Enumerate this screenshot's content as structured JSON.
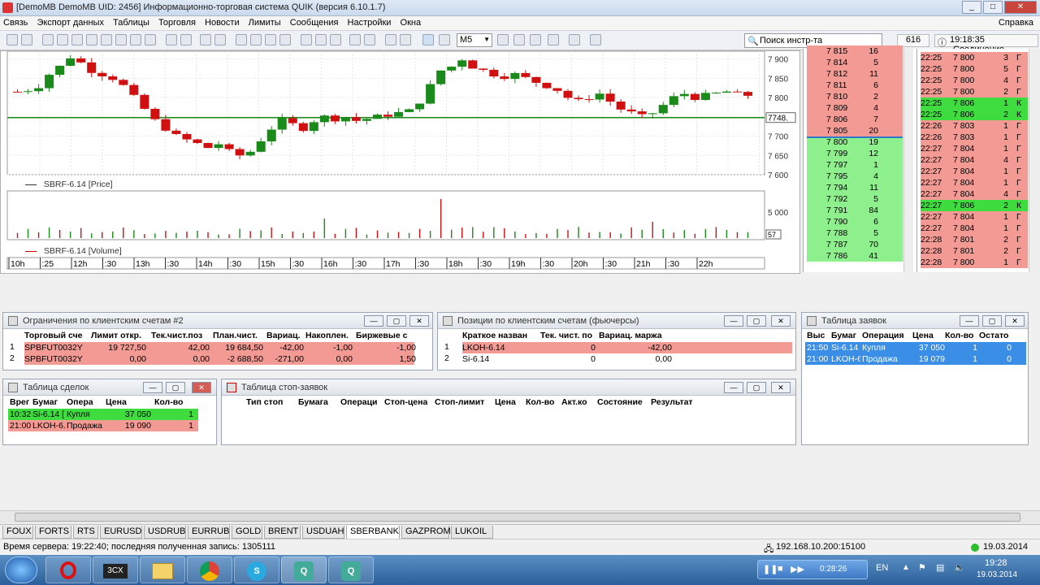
{
  "window": {
    "title": "[DemoMB DemoMB  UID: 2456] Информационно-торговая система QUIK (версия 6.10.1.7)"
  },
  "menu": [
    "Связь",
    "Экспорт данных",
    "Таблицы",
    "Торговля",
    "Новости",
    "Лимиты",
    "Сообщения",
    "Настройки",
    "Окна"
  ],
  "menu_help": "Справка",
  "toolbar": {
    "interval": "M5",
    "search_placeholder": "Поиск инстр-та",
    "counter": "616",
    "time": "19:18:35",
    "connection": "Соединение"
  },
  "chart": {
    "price_label": "SBRF-6.14 [Price]",
    "volume_label": "SBRF-6.14 [Volume]",
    "price_ticks": [
      "7 900",
      "7 850",
      "7 800",
      "7 750",
      "7 700",
      "7 650",
      "7 600"
    ],
    "current_price": "7748.",
    "volume_ticks": [
      "5 000"
    ],
    "volume_badge": "57",
    "time_ticks": [
      "10h",
      ":25",
      "12h",
      ":30",
      "13h",
      ":30",
      "14h",
      ":30",
      "15h",
      ":30",
      "16h",
      ":30",
      "17h",
      ":30",
      "18h",
      ":30",
      "19h",
      ":30",
      "20h",
      ":30",
      "21h",
      ":30",
      "22h"
    ]
  },
  "chart_data": {
    "type": "candlestick",
    "series": [
      {
        "name": "SBRF-6.14 [Price]"
      },
      {
        "name": "SBRF-6.14 [Volume]"
      }
    ],
    "ylim": [
      7600,
      7920
    ]
  },
  "orderbook": [
    {
      "price": "7 815",
      "qty": "16",
      "side": "sell"
    },
    {
      "price": "7 814",
      "qty": "5",
      "side": "sell"
    },
    {
      "price": "7 812",
      "qty": "11",
      "side": "sell"
    },
    {
      "price": "7 811",
      "qty": "6",
      "side": "sell"
    },
    {
      "price": "7 810",
      "qty": "2",
      "side": "sell"
    },
    {
      "price": "7 809",
      "qty": "4",
      "side": "sell"
    },
    {
      "price": "7 806",
      "qty": "7",
      "side": "sell"
    },
    {
      "price": "7 805",
      "qty": "20",
      "side": "sell"
    },
    {
      "price": "7 800",
      "qty": "19",
      "side": "buy"
    },
    {
      "price": "7 799",
      "qty": "12",
      "side": "buy"
    },
    {
      "price": "7 797",
      "qty": "1",
      "side": "buy"
    },
    {
      "price": "7 795",
      "qty": "4",
      "side": "buy"
    },
    {
      "price": "7 794",
      "qty": "11",
      "side": "buy"
    },
    {
      "price": "7 792",
      "qty": "5",
      "side": "buy"
    },
    {
      "price": "7 791",
      "qty": "84",
      "side": "buy"
    },
    {
      "price": "7 790",
      "qty": "6",
      "side": "buy"
    },
    {
      "price": "7 788",
      "qty": "5",
      "side": "buy"
    },
    {
      "price": "7 787",
      "qty": "70",
      "side": "buy"
    },
    {
      "price": "7 786",
      "qty": "41",
      "side": "buy"
    }
  ],
  "trades_tape": [
    {
      "time": "22:25",
      "price": "7 800",
      "qty": "3",
      "c": "Г",
      "side": "sell"
    },
    {
      "time": "22:25",
      "price": "7 800",
      "qty": "5",
      "c": "Г",
      "side": "sell"
    },
    {
      "time": "22:25",
      "price": "7 800",
      "qty": "4",
      "c": "Г",
      "side": "sell"
    },
    {
      "time": "22:25",
      "price": "7 800",
      "qty": "2",
      "c": "Г",
      "side": "sell"
    },
    {
      "time": "22:25",
      "price": "7 806",
      "qty": "1",
      "c": "К",
      "side": "buy"
    },
    {
      "time": "22:25",
      "price": "7 806",
      "qty": "2",
      "c": "К",
      "side": "buy"
    },
    {
      "time": "22:26",
      "price": "7 803",
      "qty": "1",
      "c": "Г",
      "side": "sell"
    },
    {
      "time": "22:26",
      "price": "7 803",
      "qty": "1",
      "c": "Г",
      "side": "sell"
    },
    {
      "time": "22:27",
      "price": "7 804",
      "qty": "1",
      "c": "Г",
      "side": "sell"
    },
    {
      "time": "22:27",
      "price": "7 804",
      "qty": "4",
      "c": "Г",
      "side": "sell"
    },
    {
      "time": "22:27",
      "price": "7 804",
      "qty": "1",
      "c": "Г",
      "side": "sell"
    },
    {
      "time": "22:27",
      "price": "7 804",
      "qty": "1",
      "c": "Г",
      "side": "sell"
    },
    {
      "time": "22:27",
      "price": "7 804",
      "qty": "4",
      "c": "Г",
      "side": "sell"
    },
    {
      "time": "22:27",
      "price": "7 806",
      "qty": "2",
      "c": "К",
      "side": "buy"
    },
    {
      "time": "22:27",
      "price": "7 804",
      "qty": "1",
      "c": "Г",
      "side": "sell"
    },
    {
      "time": "22:27",
      "price": "7 804",
      "qty": "1",
      "c": "Г",
      "side": "sell"
    },
    {
      "time": "22:28",
      "price": "7 801",
      "qty": "2",
      "c": "Г",
      "side": "sell"
    },
    {
      "time": "22:28",
      "price": "7 801",
      "qty": "2",
      "c": "Г",
      "side": "sell"
    },
    {
      "time": "22:28",
      "price": "7 800",
      "qty": "1",
      "c": "Г",
      "side": "sell"
    }
  ],
  "limits": {
    "title": "Ограничения по клиентским счетам #2",
    "headers": [
      "Торговый сче",
      "Лимит откр.",
      "Тек.чист.поз",
      "План.чист.",
      "Вариац.",
      "Накоплен.",
      "Биржевые с"
    ],
    "rows": [
      {
        "n": "1",
        "cells": [
          "SPBFUT0032Y",
          "19 727,50",
          "42,00",
          "19 684,50",
          "-42,00",
          "-1,00",
          "-1,00"
        ]
      },
      {
        "n": "2",
        "cells": [
          "SPBFUT0032Y",
          "0,00",
          "0,00",
          "-2 688,50",
          "-271,00",
          "0,00",
          "1,50"
        ]
      }
    ]
  },
  "positions": {
    "title": "Позиции по клиентским счетам (фьючерсы)",
    "headers": [
      "Краткое назван",
      "Тек. чист. по",
      "Вариац. маржа"
    ],
    "rows": [
      {
        "n": "1",
        "cells": [
          "LKOH-6.14",
          "0",
          "-42,00"
        ]
      },
      {
        "n": "2",
        "cells": [
          "Si-6.14",
          "0",
          "0,00"
        ]
      }
    ]
  },
  "orders": {
    "title": "Таблица заявок",
    "headers": [
      "Выс",
      "Бумаг",
      "Операция",
      "Цена",
      "Кол-во",
      "Остато"
    ],
    "rows": [
      {
        "cells": [
          "21:50",
          "Si-6.14",
          "Купля",
          "37 050",
          "1",
          "0"
        ]
      },
      {
        "cells": [
          "21:00",
          "LKOH-6.",
          "Продажа",
          "19 079",
          "1",
          "0"
        ]
      }
    ]
  },
  "deals": {
    "title": "Таблица сделок",
    "headers": [
      "Врег",
      "Бумаг",
      "Опера",
      "Цена",
      "Кол-во"
    ],
    "rows": [
      {
        "cells": [
          "10:32",
          "Si-6.14 [",
          "Купля",
          "37 050",
          "1"
        ],
        "side": "buy"
      },
      {
        "cells": [
          "21:00",
          "LKOH-6.",
          "Продажа",
          "19 090",
          "1"
        ],
        "side": "sell"
      }
    ]
  },
  "stoporders": {
    "title": "Таблица стоп-заявок",
    "headers": [
      "Тип стоп",
      "Бумага",
      "Операци",
      "Стоп-цена",
      "Стоп-лимит",
      "Цена",
      "Кол-во",
      "Акт.ко",
      "Состояние",
      "Результат"
    ]
  },
  "tabs": [
    "FOUX",
    "FORTS",
    "RTS",
    "EURUSD",
    "USDRUB",
    "EURRUB",
    "GOLD",
    "BRENT",
    "USDUAH",
    "SBERBANK",
    "GAZPROM",
    "LUKOIL"
  ],
  "selected_tab": "SBERBANK",
  "status": {
    "left": "Время сервера: 19:22:40; последняя полученная запись: 1305111",
    "ip": "192.168.10.200:15100",
    "date": "19.03.2014"
  },
  "taskbar": {
    "lang": "EN",
    "time": "19:28",
    "date": "19.03.2014",
    "media_time": "0:28:26",
    "app_3cx": "3CX"
  }
}
